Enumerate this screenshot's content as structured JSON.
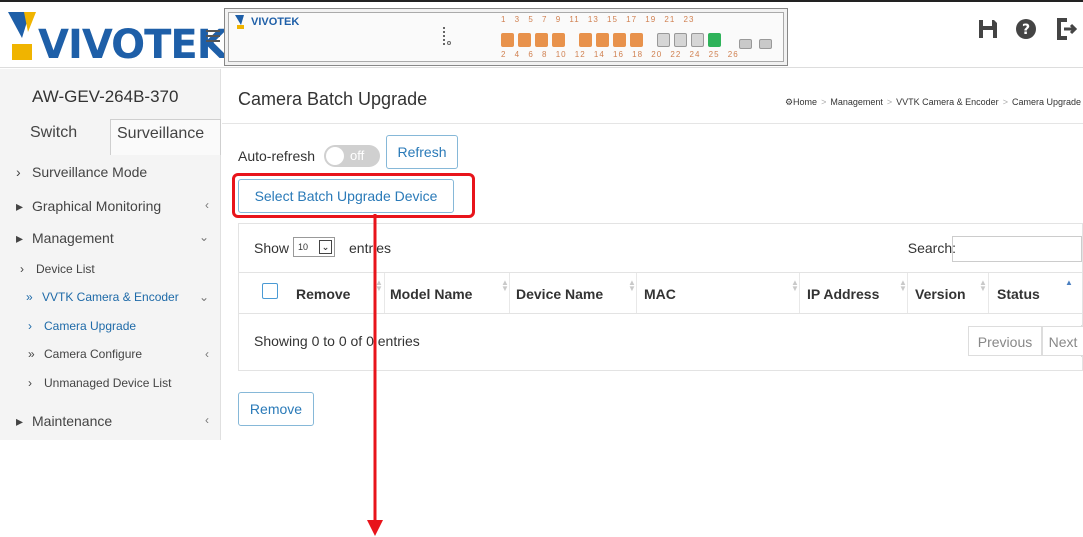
{
  "header": {
    "brand": "VIVOTEK",
    "panel_brand": "VIVOTEK",
    "port_numbers_top": "1 3 5 7 9 11 13 15 17 19 21 23",
    "port_numbers_bottom": "2 4 6 8 10 12 14 16 18 20 22 24 25 26",
    "icons": [
      "save-icon",
      "help-icon",
      "logout-icon"
    ]
  },
  "sidebar": {
    "device_name": "AW-GEV-264B-370",
    "tabs": [
      "Switch",
      "Surveillance"
    ],
    "items": [
      {
        "label": "Surveillance Mode",
        "prefix": "›"
      },
      {
        "label": "Graphical Monitoring",
        "prefix": "▸",
        "arrow": "‹"
      },
      {
        "label": "Management",
        "prefix": "▸",
        "arrow": "⌄"
      },
      {
        "label": "Device List",
        "prefix": "›"
      },
      {
        "label": "VVTK Camera & Encoder",
        "prefix": "»",
        "arrow": "⌄"
      },
      {
        "label": "Camera Upgrade",
        "prefix": "›"
      },
      {
        "label": "Camera Configure",
        "prefix": "»",
        "arrow": "‹"
      },
      {
        "label": "Unmanaged Device List",
        "prefix": "›"
      },
      {
        "label": "Maintenance",
        "prefix": "▸",
        "arrow": "‹"
      }
    ]
  },
  "main": {
    "title": "Camera Batch Upgrade",
    "breadcrumb": [
      "Home",
      "Management",
      "VVTK Camera & Encoder",
      "Camera Upgrade"
    ],
    "auto_refresh_label": "Auto-refresh",
    "toggle_state": "off",
    "refresh_button": "Refresh",
    "select_batch_button": "Select Batch Upgrade Device",
    "show_label": "Show",
    "entries_value": "10",
    "entries_label": "entries",
    "search_label": "Search:",
    "columns": [
      "Remove",
      "Model Name",
      "Device Name",
      "MAC",
      "IP Address",
      "Version",
      "Status"
    ],
    "showing_text": "Showing 0 to 0 of 0 entries",
    "previous_label": "Previous",
    "next_label": "Next",
    "remove_button": "Remove"
  },
  "colors": {
    "accent": "#2a7ab8",
    "highlight_annotation": "#e8141b",
    "brand_blue": "#1e5fa8"
  }
}
